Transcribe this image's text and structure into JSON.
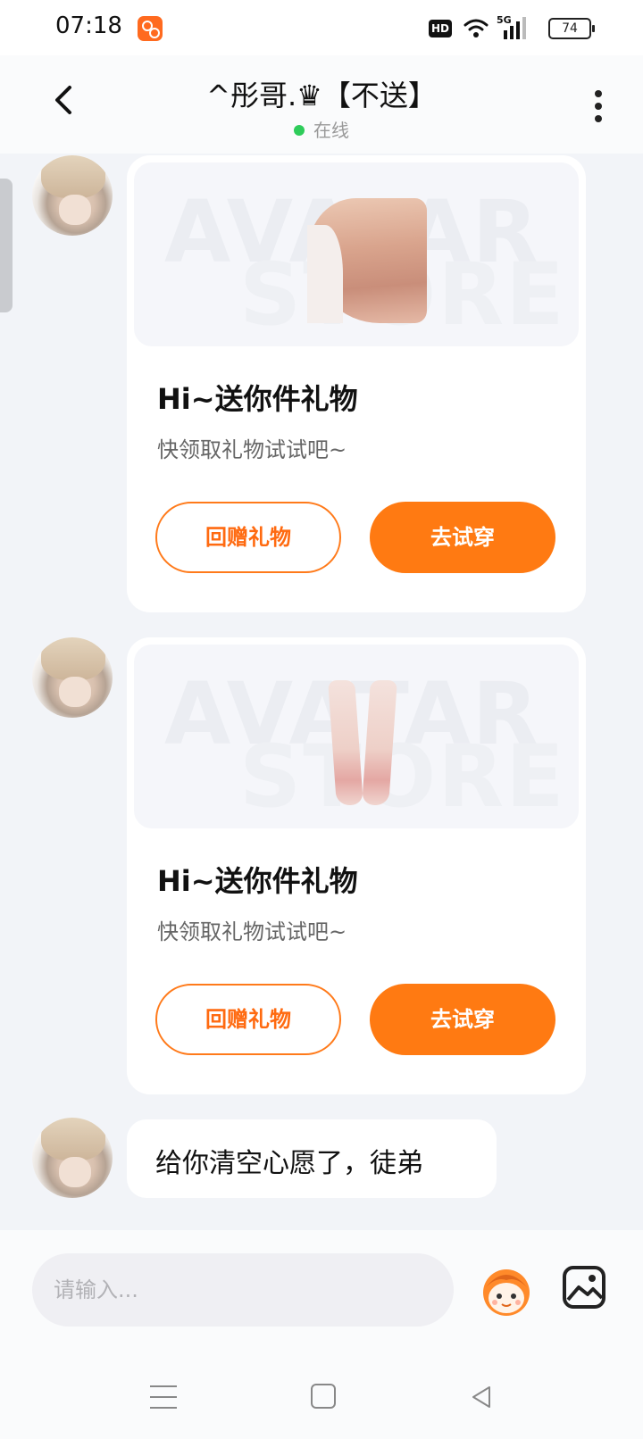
{
  "status_bar": {
    "time": "07:18",
    "hd_label": "HD",
    "network": "5G",
    "battery": "74",
    "icons": [
      "app-badge-icon",
      "wifi-icon",
      "signal-icon",
      "battery-icon"
    ]
  },
  "header": {
    "title": "^彤哥.♛【不送】",
    "status": "在线",
    "status_color": "#2ecc5a"
  },
  "messages": [
    {
      "type": "gift",
      "item": "hair",
      "watermark_top": "AVATAR",
      "watermark_bottom": "STORE",
      "title": "Hi~送你件礼物",
      "subtitle": "快领取礼物试试吧~",
      "secondary_button": "回赠礼物",
      "primary_button": "去试穿"
    },
    {
      "type": "gift",
      "item": "pants",
      "watermark_top": "AVATAR",
      "watermark_bottom": "STORE",
      "title": "Hi~送你件礼物",
      "subtitle": "快领取礼物试试吧~",
      "secondary_button": "回赠礼物",
      "primary_button": "去试穿"
    },
    {
      "type": "text",
      "text": "给你清空心愿了，徒弟"
    }
  ],
  "input": {
    "placeholder": "请输入..."
  },
  "colors": {
    "accent": "#ff7a12",
    "background": "#f2f4f8"
  }
}
